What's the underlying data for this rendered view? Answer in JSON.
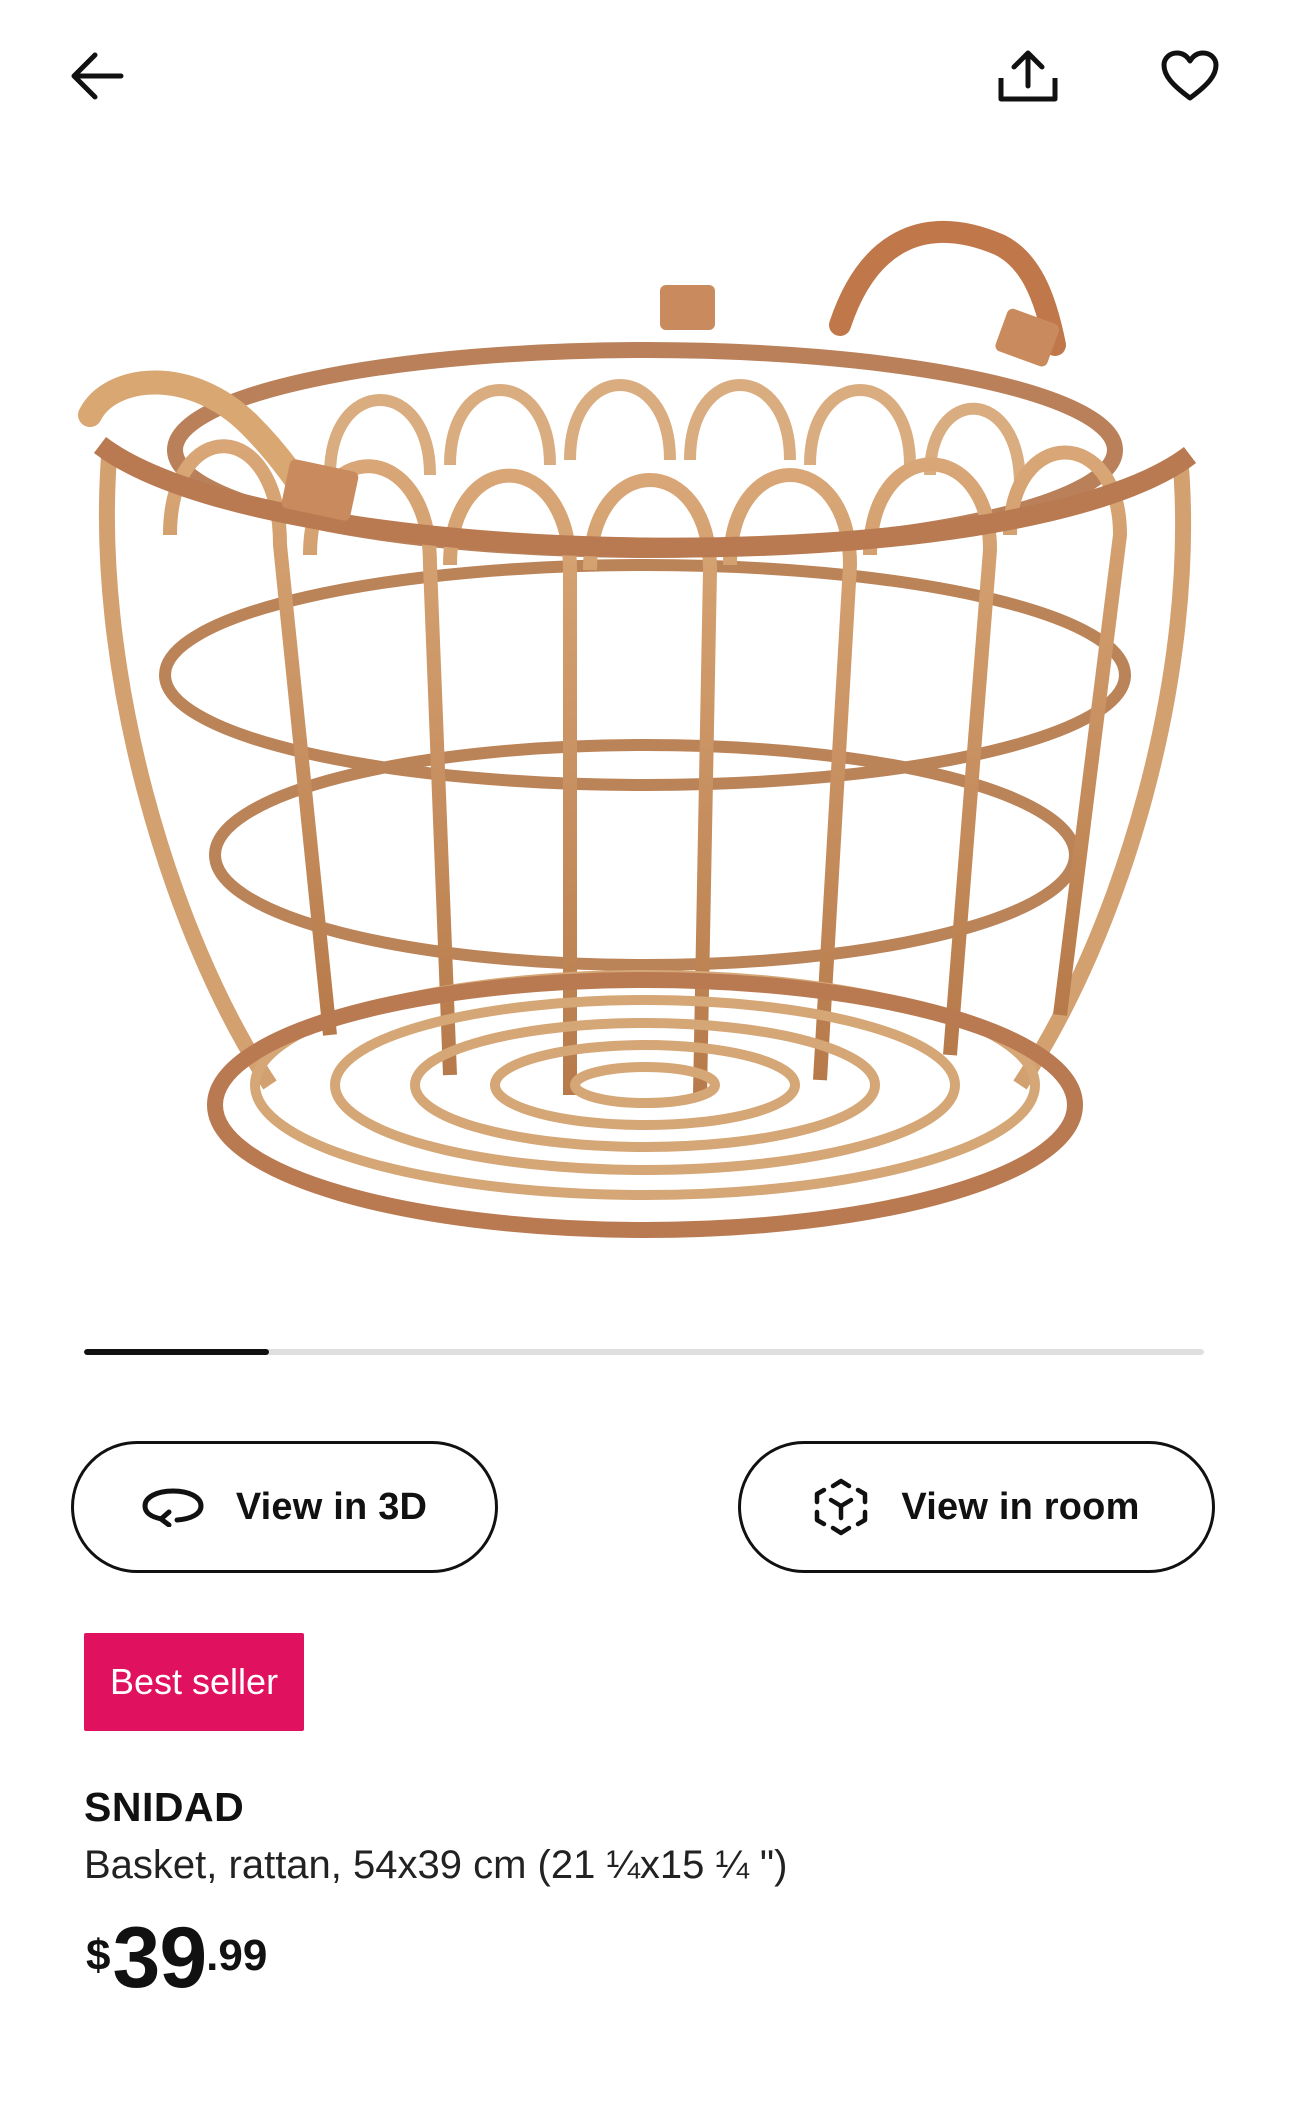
{
  "header": {
    "back_icon": "arrow-left-icon",
    "share_icon": "share-icon",
    "favorite_icon": "heart-icon"
  },
  "gallery": {
    "image_description": "product-photo",
    "progress": 0.165
  },
  "actions": {
    "view_3d_label": "View in 3D",
    "view_3d_icon": "rotate-3d-icon",
    "view_room_label": "View in room",
    "view_room_icon": "ar-cube-icon"
  },
  "badge": {
    "label": "Best seller",
    "color": "#e0115f"
  },
  "product": {
    "name": "SNIDAD",
    "description": "Basket, rattan, 54x39 cm (21 ¼x15 ¼ \")",
    "price": {
      "currency": "$",
      "integer": "39",
      "decimal": ".99"
    }
  }
}
